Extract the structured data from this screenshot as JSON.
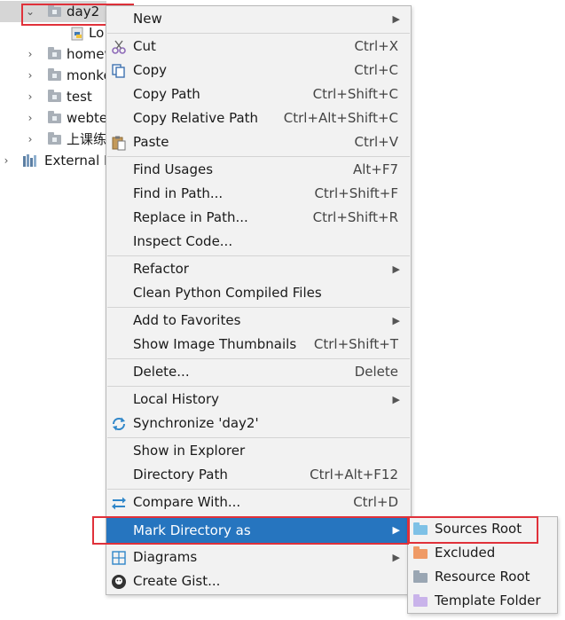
{
  "tree": {
    "rows": [
      {
        "label": "day2",
        "expanded": true
      },
      {
        "label": "Lo"
      },
      {
        "label": "homew"
      },
      {
        "label": "monke"
      },
      {
        "label": "test"
      },
      {
        "label": "webte"
      },
      {
        "label": "上课练"
      },
      {
        "label": "External L"
      }
    ]
  },
  "menu": {
    "items": [
      {
        "label": "New",
        "shortcut": "",
        "submenu": true
      },
      {
        "label": "Cut",
        "shortcut": "Ctrl+X"
      },
      {
        "label": "Copy",
        "shortcut": "Ctrl+C"
      },
      {
        "label": "Copy Path",
        "shortcut": "Ctrl+Shift+C"
      },
      {
        "label": "Copy Relative Path",
        "shortcut": "Ctrl+Alt+Shift+C"
      },
      {
        "label": "Paste",
        "shortcut": "Ctrl+V"
      },
      {
        "label": "Find Usages",
        "shortcut": "Alt+F7"
      },
      {
        "label": "Find in Path...",
        "shortcut": "Ctrl+Shift+F"
      },
      {
        "label": "Replace in Path...",
        "shortcut": "Ctrl+Shift+R"
      },
      {
        "label": "Inspect Code...",
        "shortcut": ""
      },
      {
        "label": "Refactor",
        "shortcut": "",
        "submenu": true
      },
      {
        "label": "Clean Python Compiled Files",
        "shortcut": ""
      },
      {
        "label": "Add to Favorites",
        "shortcut": "",
        "submenu": true
      },
      {
        "label": "Show Image Thumbnails",
        "shortcut": "Ctrl+Shift+T"
      },
      {
        "label": "Delete...",
        "shortcut": "Delete"
      },
      {
        "label": "Local History",
        "shortcut": "",
        "submenu": true
      },
      {
        "label": "Synchronize 'day2'",
        "shortcut": ""
      },
      {
        "label": "Show in Explorer",
        "shortcut": ""
      },
      {
        "label": "Directory Path",
        "shortcut": "Ctrl+Alt+F12"
      },
      {
        "label": "Compare With...",
        "shortcut": "Ctrl+D"
      },
      {
        "label": "Mark Directory as",
        "shortcut": "",
        "submenu": true,
        "active": true
      },
      {
        "label": "Diagrams",
        "shortcut": "",
        "submenu": true
      },
      {
        "label": "Create Gist...",
        "shortcut": ""
      }
    ]
  },
  "submenu": {
    "items": [
      {
        "label": "Sources Root",
        "color": "#7ec1e6"
      },
      {
        "label": "Excluded",
        "color": "#ef9a66"
      },
      {
        "label": "Resource Root",
        "color": "#9aa6b3"
      },
      {
        "label": "Template Folder",
        "color": "#c9b3ea"
      }
    ]
  },
  "colors": {
    "highlight_border": "#e0313a",
    "active_item_bg": "#2675bf",
    "menu_bg": "#f2f2f2"
  }
}
